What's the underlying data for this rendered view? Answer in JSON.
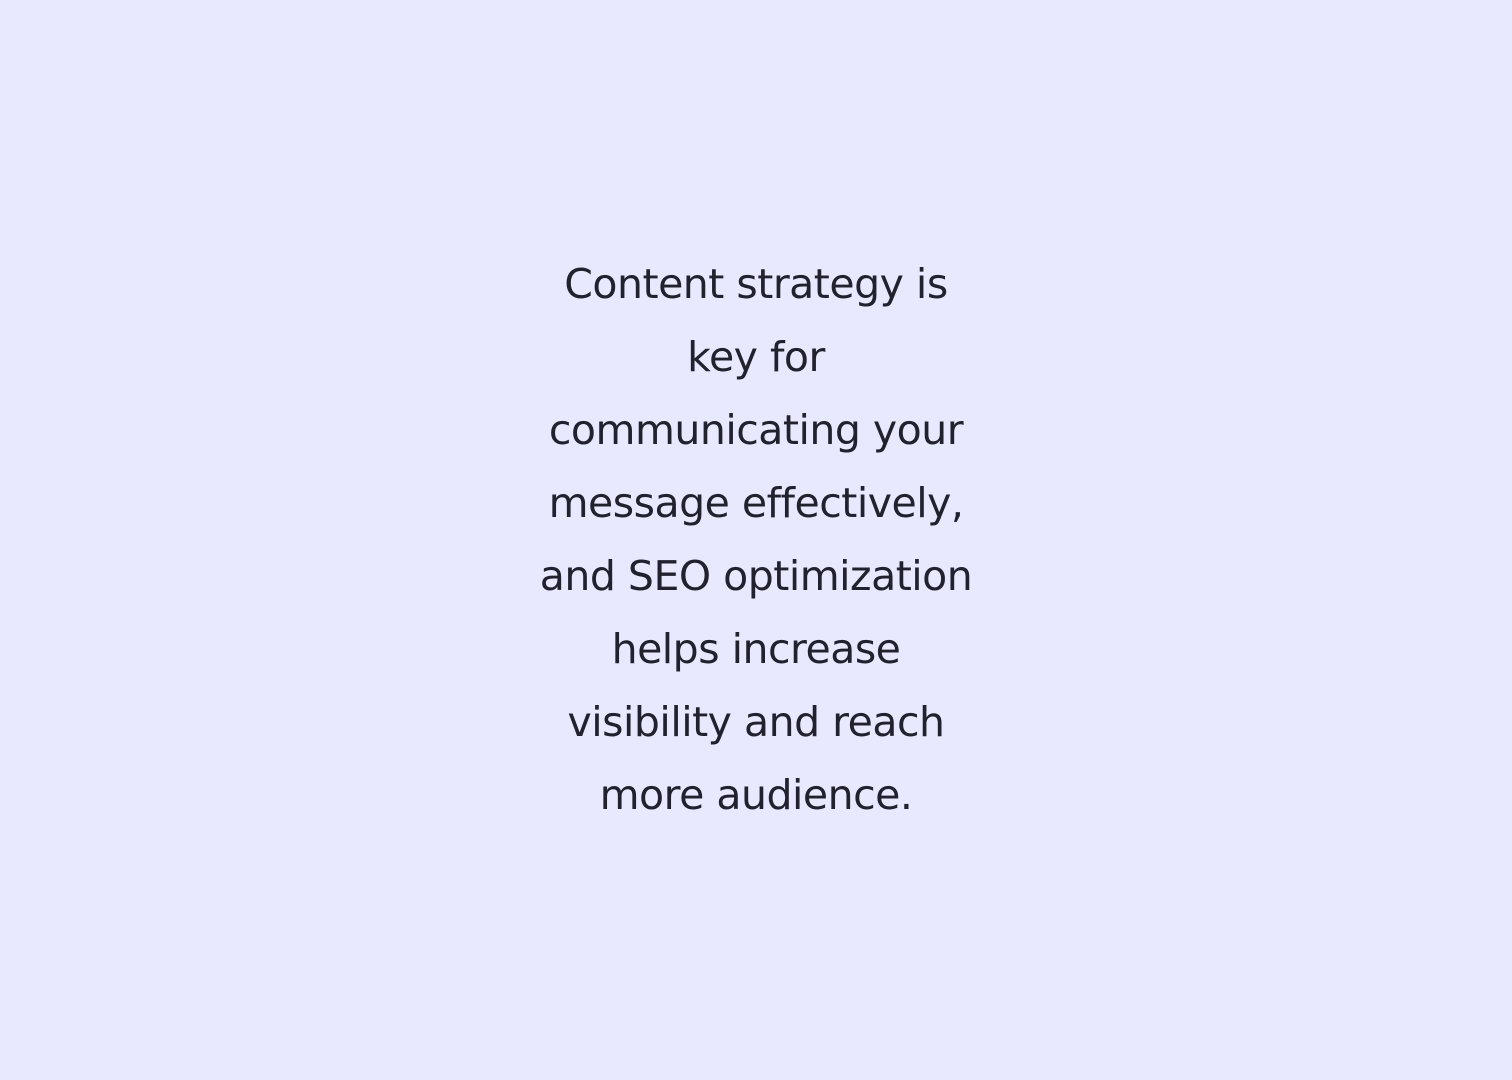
{
  "colors": {
    "background": "#e8e9fe",
    "text": "#22222e"
  },
  "content": {
    "lines": [
      "Content strategy is",
      "key for",
      "communicating your",
      "message effectively,",
      "and SEO optimization",
      "helps increase",
      "visibility and reach",
      "more audience."
    ]
  }
}
